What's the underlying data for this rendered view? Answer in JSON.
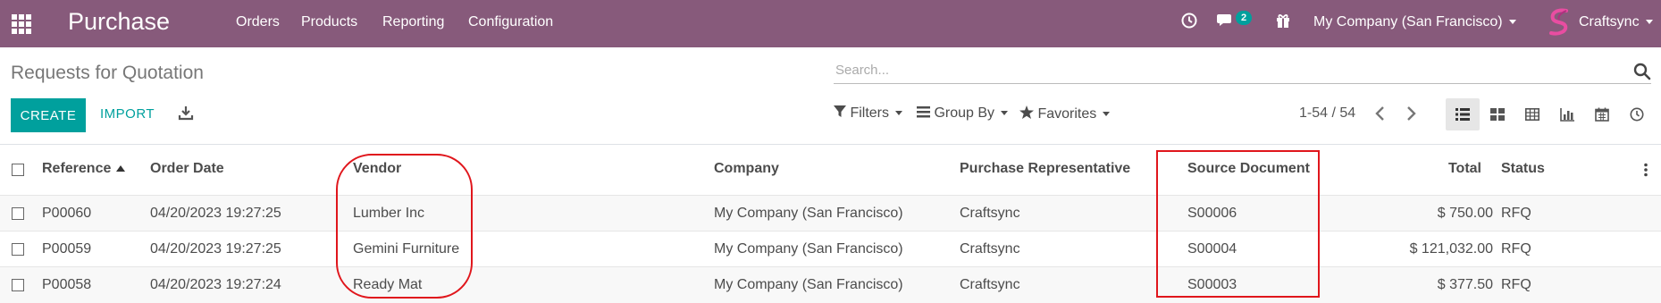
{
  "navbar": {
    "app_title": "Purchase",
    "menu": [
      "Orders",
      "Products",
      "Reporting",
      "Configuration"
    ],
    "messages_badge": "2",
    "company": "My Company (San Francisco)",
    "user": "Craftsync",
    "background_color": "#875a7b",
    "icons": [
      "apps-grid-icon",
      "clock-icon",
      "chat-icon",
      "gift-icon",
      "user-logo-icon"
    ]
  },
  "control_panel": {
    "title": "Requests for Quotation",
    "search_placeholder": "Search...",
    "create_label": "CREATE",
    "import_label": "IMPORT",
    "filters_label": "Filters",
    "group_by_label": "Group By",
    "favorites_label": "Favorites",
    "pager": "1-54 / 54",
    "accent_color": "#00a09d",
    "views": [
      "list",
      "kanban",
      "pivot",
      "graph",
      "calendar",
      "activity"
    ],
    "active_view": "list"
  },
  "table": {
    "columns": [
      "Reference",
      "Order Date",
      "Vendor",
      "Company",
      "Purchase Representative",
      "Source Document",
      "Total",
      "Status"
    ],
    "sorted_column": "Reference",
    "rows": [
      {
        "reference": "P00060",
        "order_date": "04/20/2023 19:27:25",
        "vendor": "Lumber Inc",
        "company": "My Company (San Francisco)",
        "rep": "Craftsync",
        "source": "S00006",
        "total": "$ 750.00",
        "status": "RFQ"
      },
      {
        "reference": "P00059",
        "order_date": "04/20/2023 19:27:25",
        "vendor": "Gemini Furniture",
        "company": "My Company (San Francisco)",
        "rep": "Craftsync",
        "source": "S00004",
        "total": "$ 121,032.00",
        "status": "RFQ"
      },
      {
        "reference": "P00058",
        "order_date": "04/20/2023 19:27:24",
        "vendor": "Ready Mat",
        "company": "My Company (San Francisco)",
        "rep": "Craftsync",
        "source": "S00003",
        "total": "$ 377.50",
        "status": "RFQ"
      }
    ]
  },
  "annotations": {
    "color": "#e0161c",
    "highlighted_columns": [
      "Vendor",
      "Source Document"
    ]
  }
}
